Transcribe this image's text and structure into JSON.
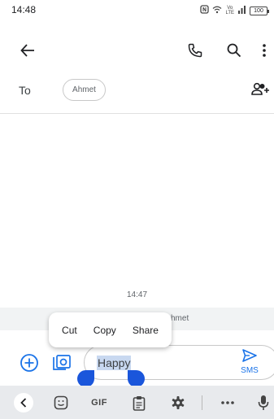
{
  "status_bar": {
    "time": "14:48",
    "network_label_top": "Vo",
    "network_label_bottom": "LTE",
    "battery": "100"
  },
  "app_bar": {
    "icons": [
      "back-arrow-icon",
      "phone-icon",
      "search-icon",
      "more-vert-icon"
    ]
  },
  "recipients": {
    "to_label": "To",
    "chip_name": "Ahmet"
  },
  "conversation": {
    "timestamp": "14:47",
    "info_text": "hmet"
  },
  "selection_menu": {
    "cut": "Cut",
    "copy": "Copy",
    "share": "Share"
  },
  "compose": {
    "text": "Happy",
    "send_label": "SMS"
  },
  "keyboard_bar": {
    "gif_label": "GIF"
  },
  "colors": {
    "accent": "#1a73e8",
    "selection_handle": "#1a56db",
    "selection_highlight": "#c8d8f0"
  }
}
